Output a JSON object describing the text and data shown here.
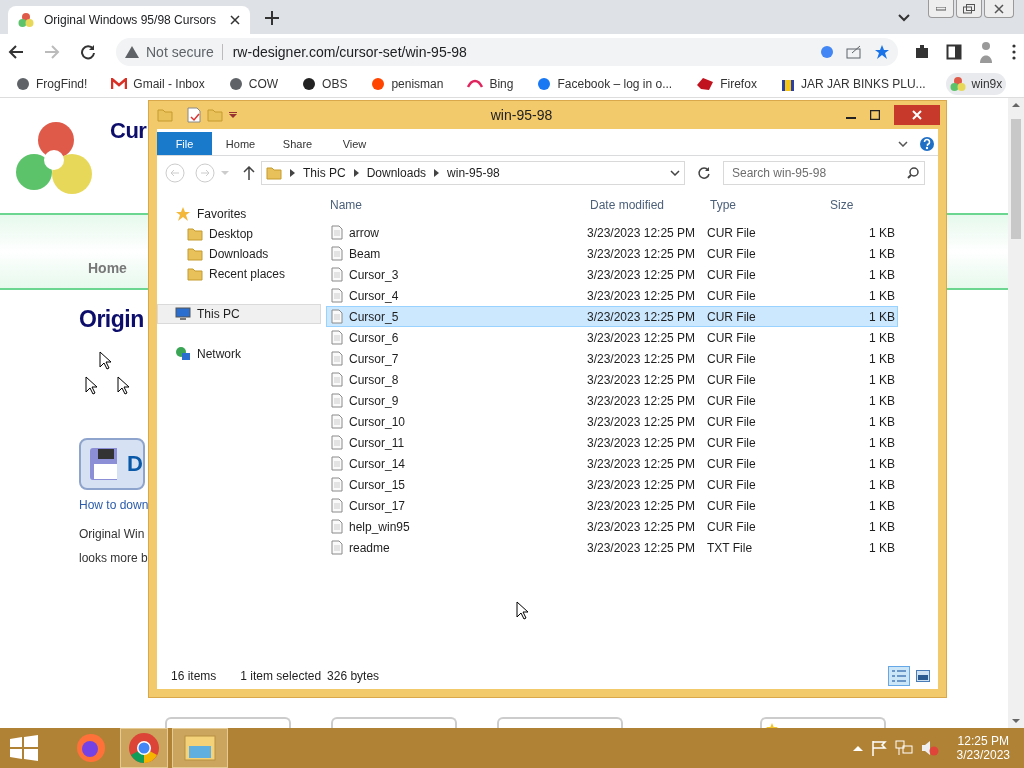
{
  "browser": {
    "tabs": [
      {
        "title": "Original Windows 95/98 Cursors",
        "selected": true
      }
    ],
    "address": {
      "security": "Not secure",
      "url": "rw-designer.com/cursor-set/win-95-98",
      "bookmarked": true
    },
    "bookmarks": [
      "FrogFind!",
      "Gmail - Inbox",
      "COW",
      "OBS",
      "penisman",
      "Bing",
      "Facebook – log in o...",
      "Firefox",
      "JAR JAR BINKS PLU...",
      "win9x"
    ]
  },
  "webpage": {
    "heading": "Cur",
    "nav": "Home",
    "title": "Origin",
    "download_button": "D",
    "link": "How to down",
    "paragraph": [
      "Original  Win",
      "looks more b"
    ]
  },
  "explorer": {
    "title": "win-95-98",
    "ribbon_tabs": [
      {
        "label": "File",
        "selected": true
      },
      {
        "label": "Home",
        "selected": false
      },
      {
        "label": "Share",
        "selected": false
      },
      {
        "label": "View",
        "selected": false
      }
    ],
    "breadcrumb": [
      "This PC",
      "Downloads",
      "win-95-98"
    ],
    "search": {
      "placeholder": "Search win-95-98"
    },
    "nav_pane": [
      {
        "label": "Favorites",
        "selected": false,
        "children": [
          {
            "label": "Desktop",
            "selected": false
          },
          {
            "label": "Downloads",
            "selected": false
          },
          {
            "label": "Recent places",
            "selected": false
          }
        ]
      },
      {
        "label": "This PC",
        "selected": true
      },
      {
        "label": "Network",
        "selected": false
      }
    ],
    "columns": [
      "Name",
      "Date modified",
      "Type",
      "Size"
    ],
    "rows": [
      {
        "name": "arrow",
        "date": "3/23/2023 12:25 PM",
        "type": "CUR File",
        "size": "1 KB",
        "selected": false
      },
      {
        "name": "Beam",
        "date": "3/23/2023 12:25 PM",
        "type": "CUR File",
        "size": "1 KB",
        "selected": false
      },
      {
        "name": "Cursor_3",
        "date": "3/23/2023 12:25 PM",
        "type": "CUR File",
        "size": "1 KB",
        "selected": false
      },
      {
        "name": "Cursor_4",
        "date": "3/23/2023 12:25 PM",
        "type": "CUR File",
        "size": "1 KB",
        "selected": false
      },
      {
        "name": "Cursor_5",
        "date": "3/23/2023 12:25 PM",
        "type": "CUR File",
        "size": "1 KB",
        "selected": true
      },
      {
        "name": "Cursor_6",
        "date": "3/23/2023 12:25 PM",
        "type": "CUR File",
        "size": "1 KB",
        "selected": false
      },
      {
        "name": "Cursor_7",
        "date": "3/23/2023 12:25 PM",
        "type": "CUR File",
        "size": "1 KB",
        "selected": false
      },
      {
        "name": "Cursor_8",
        "date": "3/23/2023 12:25 PM",
        "type": "CUR File",
        "size": "1 KB",
        "selected": false
      },
      {
        "name": "Cursor_9",
        "date": "3/23/2023 12:25 PM",
        "type": "CUR File",
        "size": "1 KB",
        "selected": false
      },
      {
        "name": "Cursor_10",
        "date": "3/23/2023 12:25 PM",
        "type": "CUR File",
        "size": "1 KB",
        "selected": false
      },
      {
        "name": "Cursor_11",
        "date": "3/23/2023 12:25 PM",
        "type": "CUR File",
        "size": "1 KB",
        "selected": false
      },
      {
        "name": "Cursor_14",
        "date": "3/23/2023 12:25 PM",
        "type": "CUR File",
        "size": "1 KB",
        "selected": false
      },
      {
        "name": "Cursor_15",
        "date": "3/23/2023 12:25 PM",
        "type": "CUR File",
        "size": "1 KB",
        "selected": false
      },
      {
        "name": "Cursor_17",
        "date": "3/23/2023 12:25 PM",
        "type": "CUR File",
        "size": "1 KB",
        "selected": false
      },
      {
        "name": "help_win95",
        "date": "3/23/2023 12:25 PM",
        "type": "CUR File",
        "size": "1 KB",
        "selected": false
      },
      {
        "name": "readme",
        "date": "3/23/2023 12:25 PM",
        "type": "TXT File",
        "size": "1 KB",
        "selected": false
      }
    ],
    "status": {
      "count": "16 items",
      "selection": "1 item selected",
      "bytes": "326 bytes"
    },
    "views": [
      {
        "kind": "details",
        "selected": true
      },
      {
        "kind": "tiles",
        "selected": false
      }
    ]
  },
  "taskbar": {
    "apps": [
      {
        "kind": "firefox",
        "selected": false
      },
      {
        "kind": "chrome",
        "selected": true
      },
      {
        "kind": "explorer",
        "selected": true
      }
    ],
    "time": "12:25 PM",
    "date": "3/23/2023"
  }
}
